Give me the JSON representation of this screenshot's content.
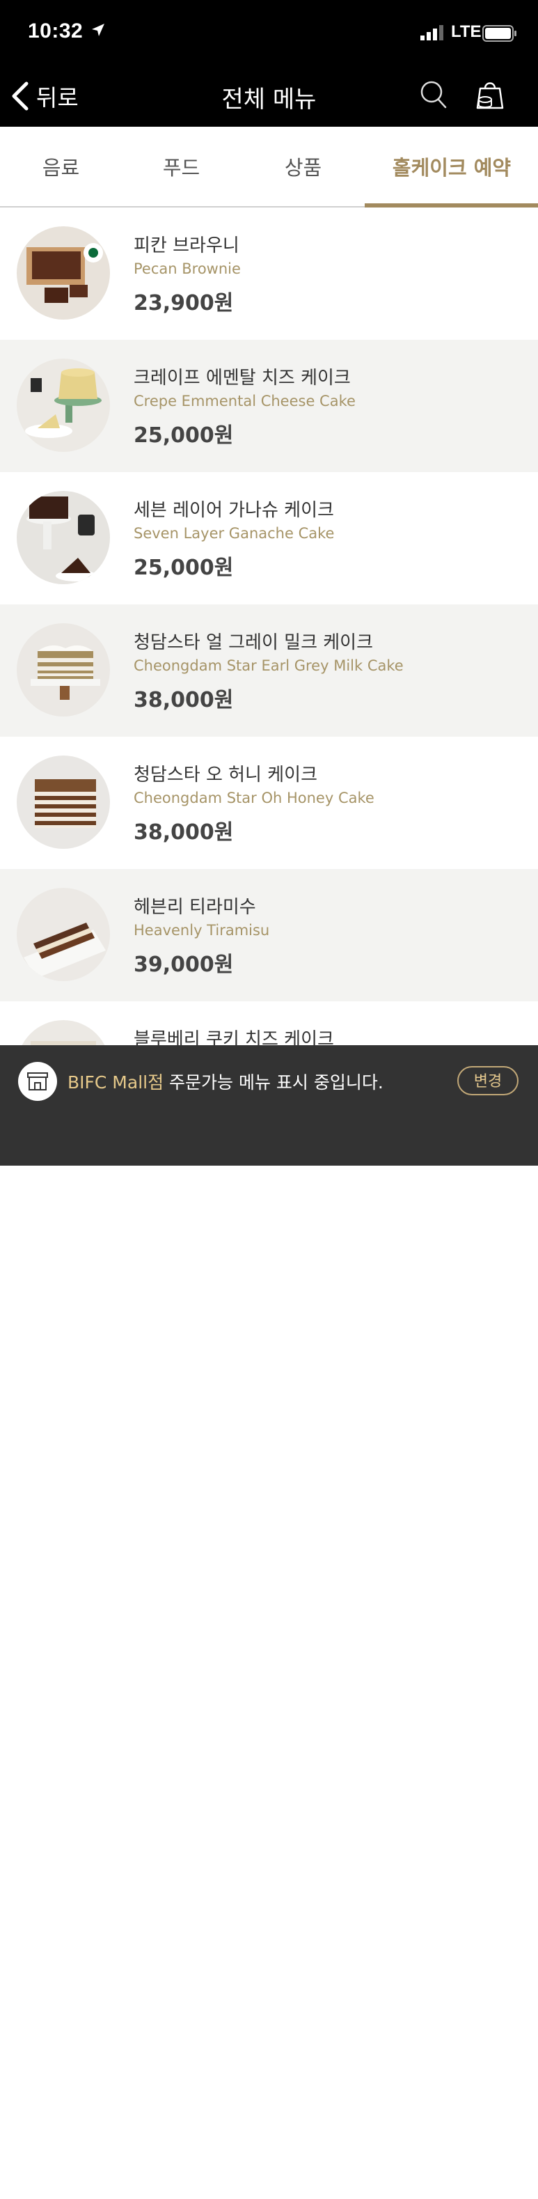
{
  "status_bar": {
    "time": "10:32",
    "network": "LTE"
  },
  "nav": {
    "back_label": "뒤로",
    "title": "전체 메뉴"
  },
  "tabs": [
    {
      "label": "음료"
    },
    {
      "label": "푸드"
    },
    {
      "label": "상품"
    },
    {
      "label": "홀케이크 예약"
    }
  ],
  "active_tab": "홀케이크 예약",
  "items": [
    {
      "name_ko": "피칸 브라우니",
      "name_en": "Pecan Brownie",
      "price": "23,900원"
    },
    {
      "name_ko": "크레이프 에멘탈 치즈 케이크",
      "name_en": "Crepe Emmental Cheese Cake",
      "price": "25,000원"
    },
    {
      "name_ko": "세븐 레이어 가나슈 케이크",
      "name_en": "Seven Layer Ganache Cake",
      "price": "25,000원"
    },
    {
      "name_ko": "청담스타 얼 그레이 밀크 케이크",
      "name_en": "Cheongdam Star Earl Grey Milk Cake",
      "price": "38,000원"
    },
    {
      "name_ko": "청담스타 오 허니 케이크",
      "name_en": "Cheongdam Star Oh Honey Cake",
      "price": "38,000원"
    },
    {
      "name_ko": "헤븐리 티라미수",
      "name_en": "Heavenly Tiramisu",
      "price": "39,000원"
    },
    {
      "name_ko": "블루베리 쿠키 치즈 케이크",
      "name_en": "",
      "price": ""
    }
  ],
  "store_bar": {
    "store_name": "BIFC Mall점",
    "message": " 주문가능 메뉴 표시 중입니다.",
    "change_label": "변경"
  },
  "colors": {
    "accent": "#a28a5e",
    "english_name": "#a69467",
    "store_bar_bg": "#333333",
    "nav_bg": "#000000"
  }
}
